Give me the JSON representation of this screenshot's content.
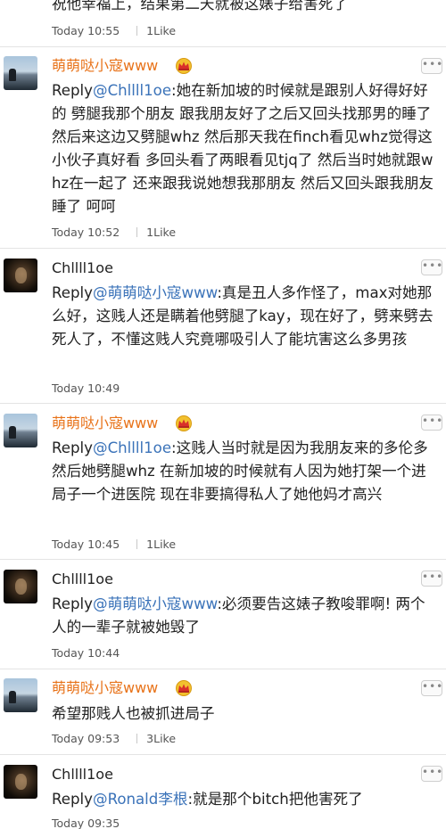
{
  "comments": [
    {
      "body": "祝他幸福上，结果第二天就被这婊子给害死了",
      "time": "Today 10:55",
      "likes": "1Like"
    },
    {
      "username": "萌萌哒小寇www",
      "crown_icon": "crown-icon",
      "reply_kw": "Reply",
      "mention": "@Chllll1oe",
      "text": ":她在新加坡的时候就是跟别人好得好好的 劈腿我那个朋友 跟我朋友好了之后又回头找那男的睡了 然后来这边又劈腿whz 然后那天我在finch看见whz觉得这小伙子真好看 多回头看了两眼看见tjq了 然后当时她就跟whz在一起了 还来跟我说她想我那朋友 然后又回头跟我朋友睡了 呵呵",
      "time": "Today 10:52",
      "likes": "1Like"
    },
    {
      "username": "Chllll1oe",
      "reply_kw": "Reply",
      "mention": "@萌萌哒小寇www",
      "text": ":真是丑人多作怪了，max对她那么好，这贱人还是瞒着他劈腿了kay，现在好了，劈来劈去死人了，不懂这贱人究竟哪吸引人了能坑害这么多男孩",
      "time": "Today 10:49"
    },
    {
      "username": "萌萌哒小寇www",
      "reply_kw": "Reply",
      "mention": "@Chllll1oe",
      "text": ":这贱人当时就是因为我朋友来的多伦多 然后她劈腿whz 在新加坡的时候就有人因为她打架一个进局子一个进医院 现在非要搞得私人了她他妈才高兴",
      "time": "Today 10:45",
      "likes": "1Like"
    },
    {
      "username": "Chllll1oe",
      "reply_kw": "Reply",
      "mention": "@萌萌哒小寇www",
      "text": ":必须要告这婊子教唆罪啊! 两个人的一辈子就被她毁了",
      "time": "Today 10:44"
    },
    {
      "username": "萌萌哒小寇www",
      "text": "希望那贱人也被抓进局子",
      "time": "Today 09:53",
      "likes": "3Like"
    },
    {
      "username": "Chllll1oe",
      "reply_kw": "Reply",
      "mention": "@Ronald李根",
      "text": ":就是那个bitch把他害死了",
      "time": "Today 09:35"
    }
  ],
  "more_button": {
    "icon": "more-dots-icon",
    "label": "•••"
  },
  "colors": {
    "username_vip": "#e8731a",
    "mention": "#3b73b9",
    "meta": "#555555",
    "divider": "#e4e4e4"
  }
}
